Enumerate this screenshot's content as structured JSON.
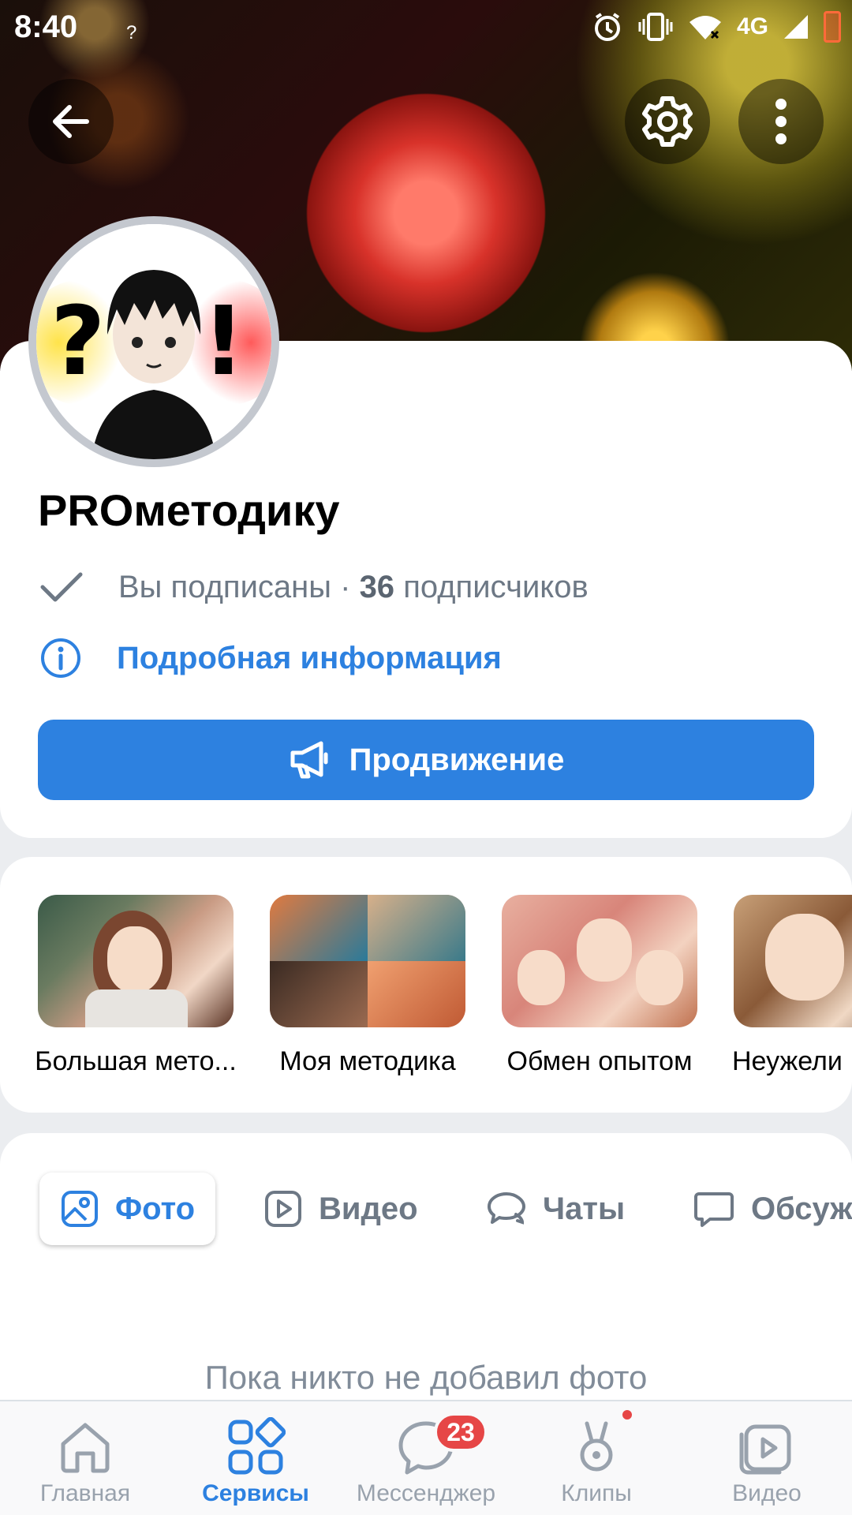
{
  "status_bar": {
    "time": "8:40",
    "notification": "?",
    "network": "4G"
  },
  "cover": {
    "back_icon": "arrow-left-icon",
    "settings_icon": "gear-icon",
    "more_icon": "more-vertical-icon"
  },
  "profile": {
    "name": "PROметодику",
    "subscribed_text": "Вы подписаны ·",
    "subscribers_count": "36",
    "subscribers_word": "подписчиков",
    "info_link": "Подробная информация",
    "promo_button": "Продвижение"
  },
  "albums": [
    {
      "label": "Большая мето..."
    },
    {
      "label": "Моя методика"
    },
    {
      "label": "Обмен опытом"
    },
    {
      "label": "Неужели"
    }
  ],
  "tabs": [
    {
      "label": "Фото",
      "icon": "image-icon"
    },
    {
      "label": "Видео",
      "icon": "play-icon"
    },
    {
      "label": "Чаты",
      "icon": "chats-icon"
    },
    {
      "label": "Обсуж",
      "icon": "comment-icon"
    }
  ],
  "empty_state": "Пока никто не добавил фото",
  "bottom_nav": [
    {
      "label": "Главная",
      "icon": "home-icon"
    },
    {
      "label": "Сервисы",
      "icon": "services-icon"
    },
    {
      "label": "Мессенджер",
      "icon": "messenger-icon",
      "badge": "23"
    },
    {
      "label": "Клипы",
      "icon": "clips-icon"
    },
    {
      "label": "Видео",
      "icon": "video-icon"
    }
  ],
  "colors": {
    "accent": "#2d81e0",
    "badge": "#e64646",
    "secondary_text": "#6d7885"
  }
}
